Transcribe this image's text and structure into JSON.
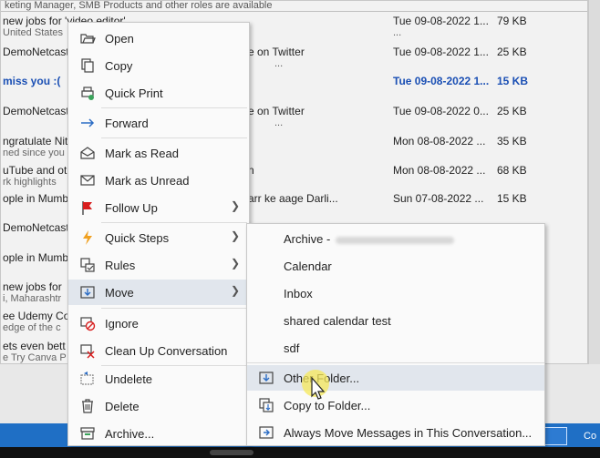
{
  "email_list": {
    "header_line": "keting Manager, SMB Products and other roles are available",
    "rows": [
      {
        "line": "new jobs for 'video editor'",
        "sub": "United States",
        "mid": "",
        "date": "Tue 09-08-2022 1...",
        "size": "79 KB",
        "bold": false
      },
      {
        "line": "DemoNetcast,",
        "sub": "",
        "mid": "e on Twitter",
        "date": "Tue 09-08-2022 1...",
        "size": "25 KB",
        "bold": false
      },
      {
        "line": "miss you :(",
        "sub": "",
        "mid": "",
        "date": "Tue 09-08-2022 1...",
        "size": "15 KB",
        "bold": true
      },
      {
        "line": "DemoNetcast,",
        "sub": "",
        "mid": "e on Twitter",
        "date": "Tue 09-08-2022 0...",
        "size": "25 KB",
        "bold": false
      },
      {
        "line": "ngratulate Nit",
        "sub": "ned since you",
        "mid": "",
        "date": "Mon 08-08-2022 ...",
        "size": "35 KB",
        "bold": false
      },
      {
        "line": "uTube and oth",
        "sub": "rk highlights",
        "mid": "n",
        "date": "Mon 08-08-2022 ...",
        "size": "68 KB",
        "bold": false
      },
      {
        "line": "ople in Mumb",
        "sub": "",
        "mid": "arr ke aage Darli...",
        "date": "Sun 07-08-2022 ...",
        "size": "15 KB",
        "bold": false
      },
      {
        "line": "DemoNetcast,",
        "sub": "",
        "mid": "",
        "date": "",
        "size": "",
        "bold": false
      },
      {
        "line": "ople in Mumb",
        "sub": "",
        "mid": "",
        "date": "",
        "size": "",
        "bold": false
      },
      {
        "line": "new jobs for",
        "sub": "i, Maharashtr",
        "mid": "",
        "date": "",
        "size": "",
        "bold": false
      },
      {
        "line": "ee Udemy Cou",
        "sub": "edge of the c",
        "mid": "",
        "date": "",
        "size": "",
        "bold": false
      },
      {
        "line": "ets even bett",
        "sub": "e Try Canva P",
        "mid": "",
        "date": "",
        "size": "",
        "bold": false
      }
    ],
    "dots": "..."
  },
  "context_menu": {
    "items": [
      {
        "label": "Open",
        "icon": "open-folder-icon"
      },
      {
        "label": "Copy",
        "icon": "copy-icon"
      },
      {
        "label": "Quick Print",
        "icon": "printer-icon"
      },
      {
        "label": "Forward",
        "icon": "forward-arrow-icon"
      },
      {
        "label": "Mark as Read",
        "icon": "envelope-open-icon"
      },
      {
        "label": "Mark as Unread",
        "icon": "envelope-icon"
      },
      {
        "label": "Follow Up",
        "icon": "flag-icon"
      },
      {
        "label": "Quick Steps",
        "icon": "lightning-icon"
      },
      {
        "label": "Rules",
        "icon": "rules-icon"
      },
      {
        "label": "Move",
        "icon": "move-folder-icon"
      },
      {
        "label": "Ignore",
        "icon": "ignore-icon"
      },
      {
        "label": "Clean Up Conversation",
        "icon": "clean-up-icon"
      },
      {
        "label": "Undelete",
        "icon": "undelete-icon"
      },
      {
        "label": "Delete",
        "icon": "trash-icon"
      },
      {
        "label": "Archive...",
        "icon": "archive-icon"
      }
    ]
  },
  "move_submenu": {
    "folders": [
      "Archive -",
      "Calendar",
      "Inbox",
      "shared calendar test",
      "sdf"
    ],
    "actions": [
      {
        "label": "Other Folder...",
        "icon": "folder-arrow-icon"
      },
      {
        "label": "Copy to Folder...",
        "icon": "copy-folder-icon"
      },
      {
        "label": "Always Move Messages in This Conversation...",
        "icon": "always-move-icon"
      }
    ]
  },
  "status_bar": {
    "right_text": "Co"
  },
  "colors": {
    "accent": "#1f6fc5",
    "unread": "#1a4fb4",
    "highlight": "#e1e6ed",
    "flag": "#d81e1e",
    "lightning": "#f0a020"
  }
}
